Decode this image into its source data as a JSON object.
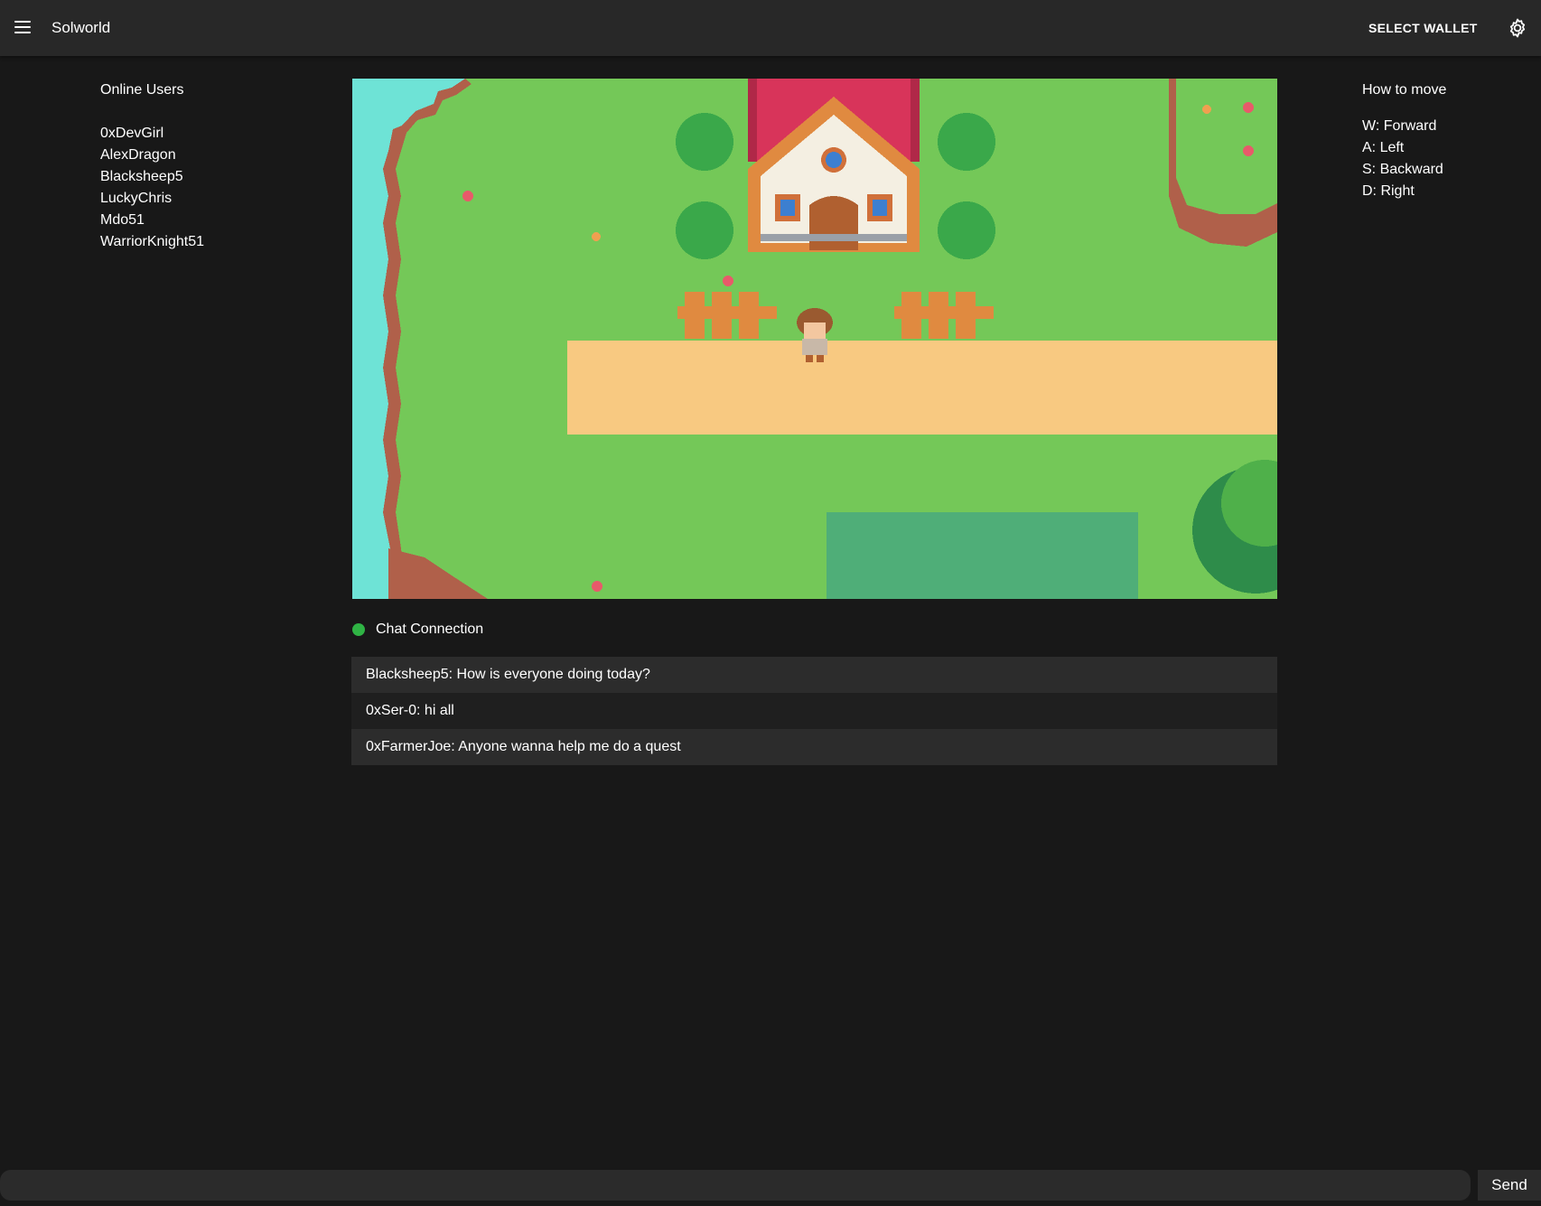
{
  "header": {
    "title": "Solworld",
    "menu_icon": "hamburger-menu-icon",
    "wallet_label": "SELECT WALLET",
    "settings_icon": "gear-icon"
  },
  "sidebar": {
    "title": "Online Users",
    "users": [
      "0xDevGirl",
      "AlexDragon",
      "Blacksheep5",
      "LuckyChris",
      "Mdo51",
      "WarriorKnight51"
    ]
  },
  "instructions": {
    "title": "How to move",
    "controls": [
      "W: Forward",
      "A: Left",
      "S: Backward",
      "D: Right"
    ]
  },
  "chat": {
    "status_label": "Chat Connection",
    "status_color": "#2fb344",
    "messages": [
      "Blacksheep5: How is everyone doing today?",
      "0xSer-0: hi all",
      "0xFarmerJoe: Anyone wanna help me do a quest"
    ],
    "input_value": "",
    "send_label": "Send"
  },
  "colors": {
    "background": "#181818",
    "app_bar": "#282828",
    "grass": "#74c858",
    "water": "#6ee3d6",
    "path": "#f8c981",
    "roof": "#d8345a"
  }
}
